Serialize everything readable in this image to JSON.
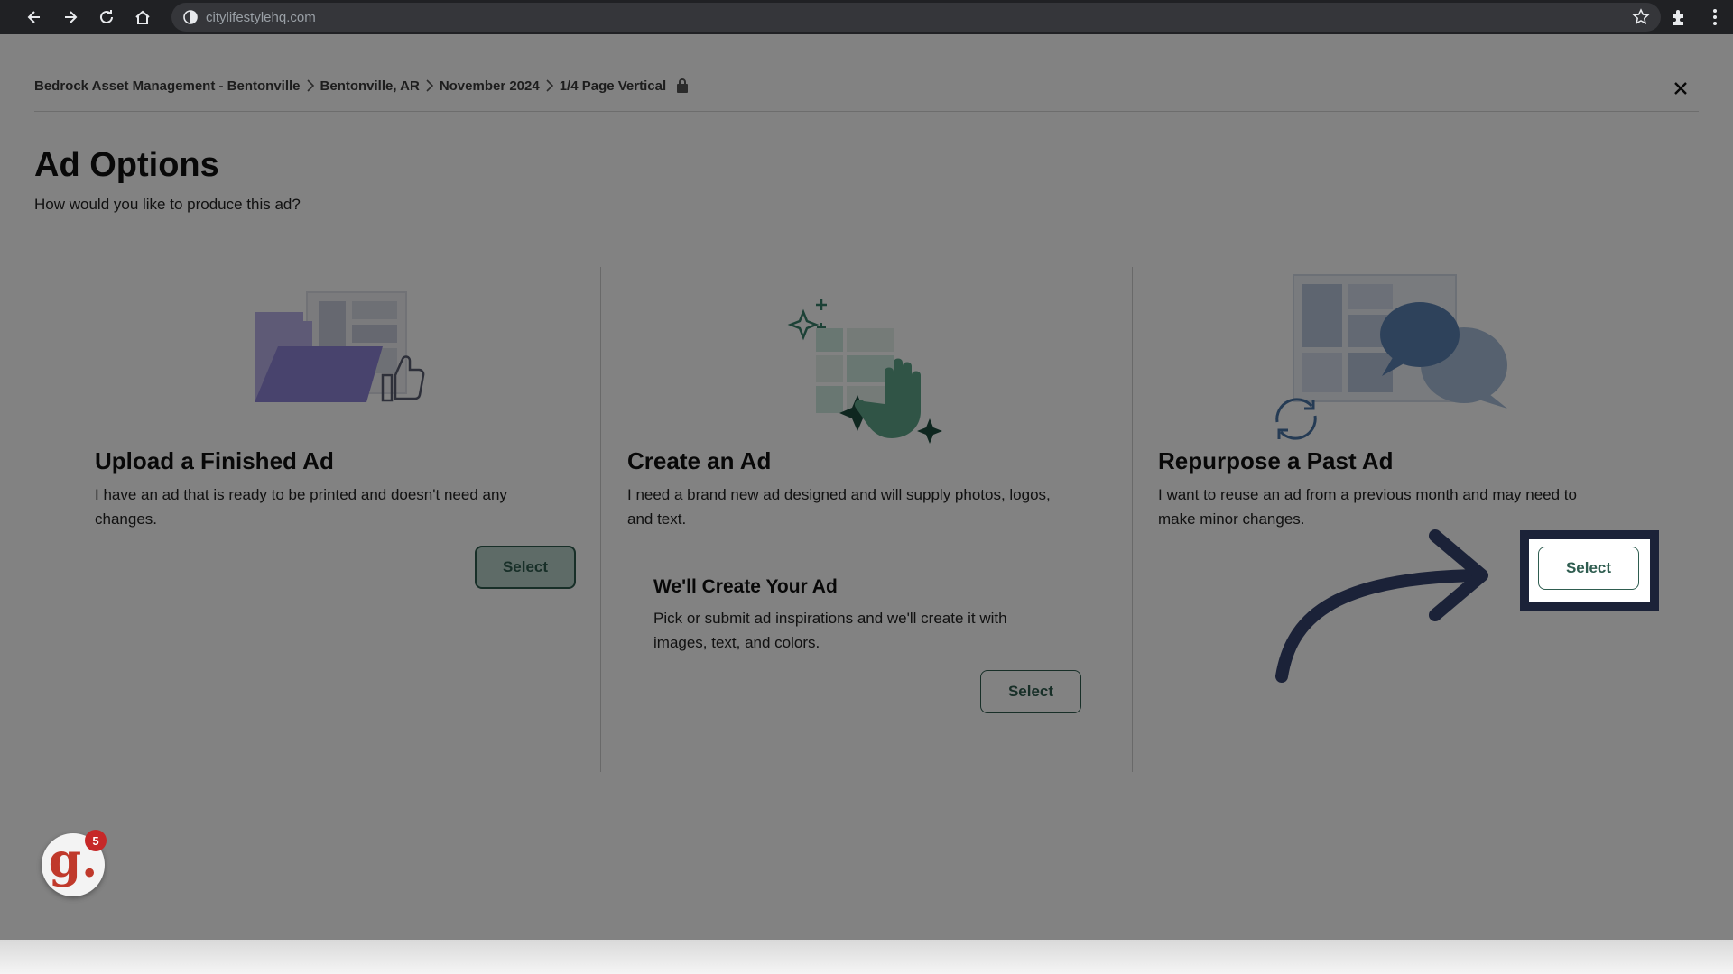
{
  "browser": {
    "url": "citylifestylehq.com",
    "icons": [
      "back-arrow-icon",
      "forward-arrow-icon",
      "reload-icon",
      "home-icon",
      "site-info-icon",
      "bookmark-star-icon",
      "extensions-icon",
      "kebab-menu-icon"
    ]
  },
  "breadcrumb": {
    "items": [
      "Bedrock Asset Management - Bentonville",
      "Bentonville, AR",
      "November 2024",
      "1/4 Page Vertical"
    ]
  },
  "header": {
    "title": "Ad Options",
    "subtitle": "How would you like to produce this ad?"
  },
  "options": [
    {
      "title": "Upload a Finished Ad",
      "description_line1": "I have an ad that is ready to be printed and doesn't need any",
      "description_line2": "changes.",
      "button_label": "Select"
    },
    {
      "title": "Create an Ad",
      "description_line1": "I need a brand new ad designed and will supply photos, logos,",
      "description_line2": "and text.",
      "sub_option": {
        "title": "We'll Create Your Ad",
        "description_line1": "Pick or submit ad inspirations and we'll create it with",
        "description_line2": "images, text, and colors.",
        "button_label": "Select"
      }
    },
    {
      "title": "Repurpose a Past Ad",
      "description_line1": "I want to reuse an ad from a previous month and may need to",
      "description_line2": "make minor changes.",
      "button_label": "Select"
    }
  ],
  "widget": {
    "letter": "g.",
    "badge_count": "5"
  },
  "colors": {
    "accent": "#2f5d50",
    "highlight": "#1b2238",
    "overlay": "rgba(0,0,0,0.49)"
  }
}
